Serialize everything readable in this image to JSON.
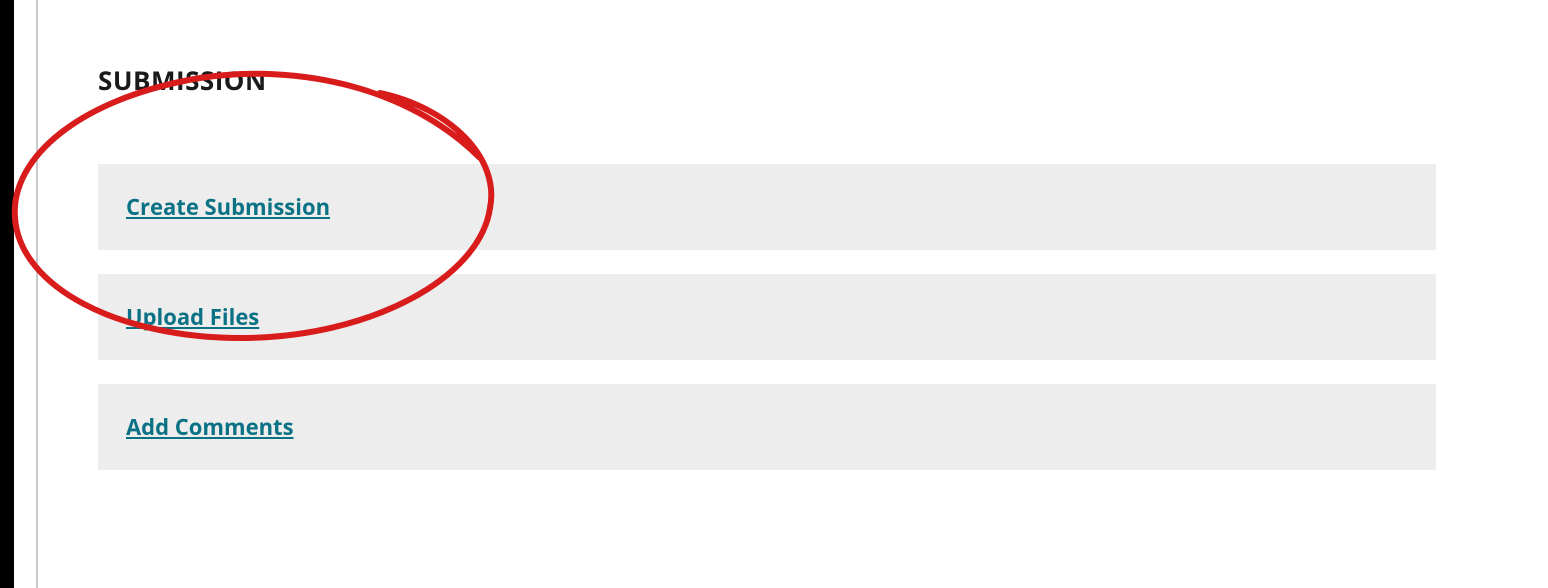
{
  "section": {
    "heading": "SUBMISSION",
    "links": [
      {
        "label": "Create Submission"
      },
      {
        "label": "Upload Files"
      },
      {
        "label": "Add Comments"
      }
    ]
  }
}
